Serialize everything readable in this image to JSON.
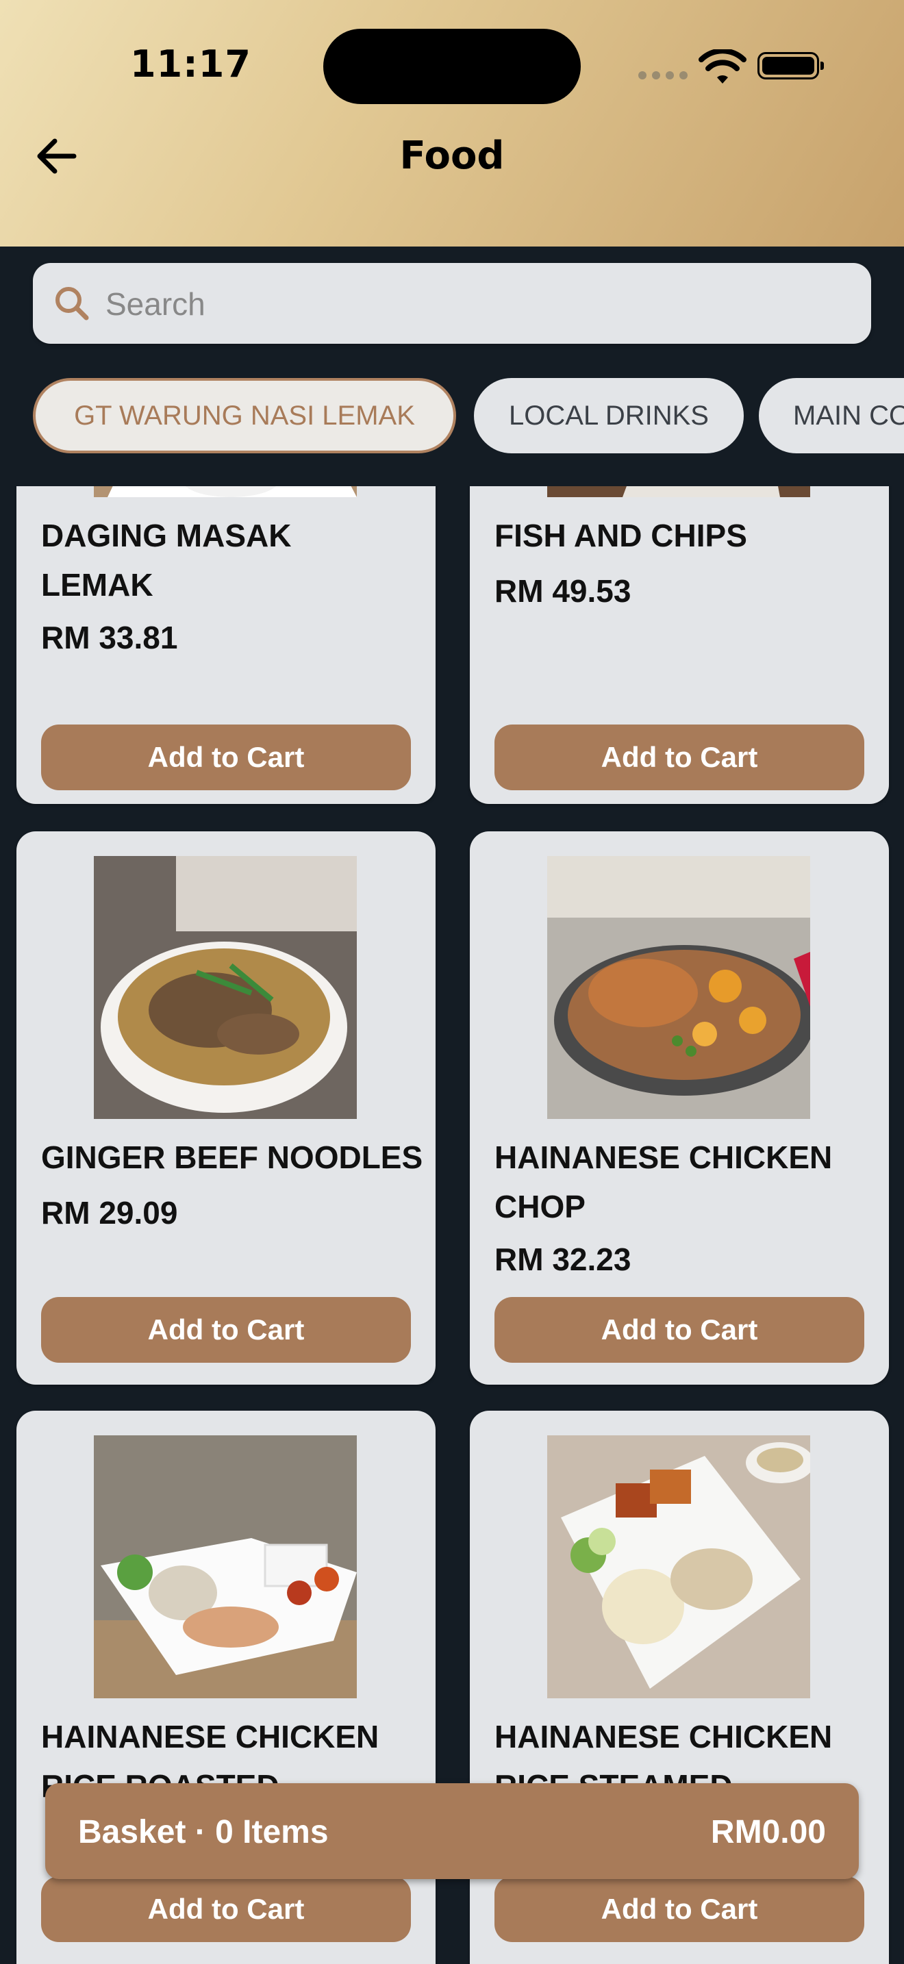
{
  "status_bar": {
    "time": "11:17"
  },
  "header": {
    "title": "Food"
  },
  "search": {
    "placeholder": "Search"
  },
  "categories": [
    {
      "label": "GT WARUNG NASI LEMAK",
      "active": true
    },
    {
      "label": "LOCAL DRINKS",
      "active": false
    },
    {
      "label": "MAIN CO",
      "active": false
    }
  ],
  "products": [
    {
      "name_line1": "DAGING MASAK",
      "name_line2": "LEMAK",
      "price": "RM 33.81",
      "button": "Add to Cart"
    },
    {
      "name_line1": "FISH AND CHIPS",
      "name_line2": "",
      "price": "RM 49.53",
      "button": "Add to Cart"
    },
    {
      "name_line1": "GINGER BEEF NOODLES",
      "name_line2": "",
      "price": "RM 29.09",
      "button": "Add to Cart"
    },
    {
      "name_line1": "HAINANESE CHICKEN",
      "name_line2": "CHOP",
      "price": "RM 32.23",
      "button": "Add to Cart"
    },
    {
      "name_line1": "HAINANESE CHICKEN",
      "name_line2": "RICE ROASTED",
      "price": "",
      "button": "Add to Cart"
    },
    {
      "name_line1": "HAINANESE CHICKEN",
      "name_line2": "RICE STEAMED",
      "price": "",
      "button": "Add to Cart"
    }
  ],
  "basket": {
    "label": "Basket · 0 Items",
    "total": "RM0.00"
  },
  "colors": {
    "accent": "#a87b59",
    "background": "#141c24",
    "card": "#e3e5e8"
  }
}
